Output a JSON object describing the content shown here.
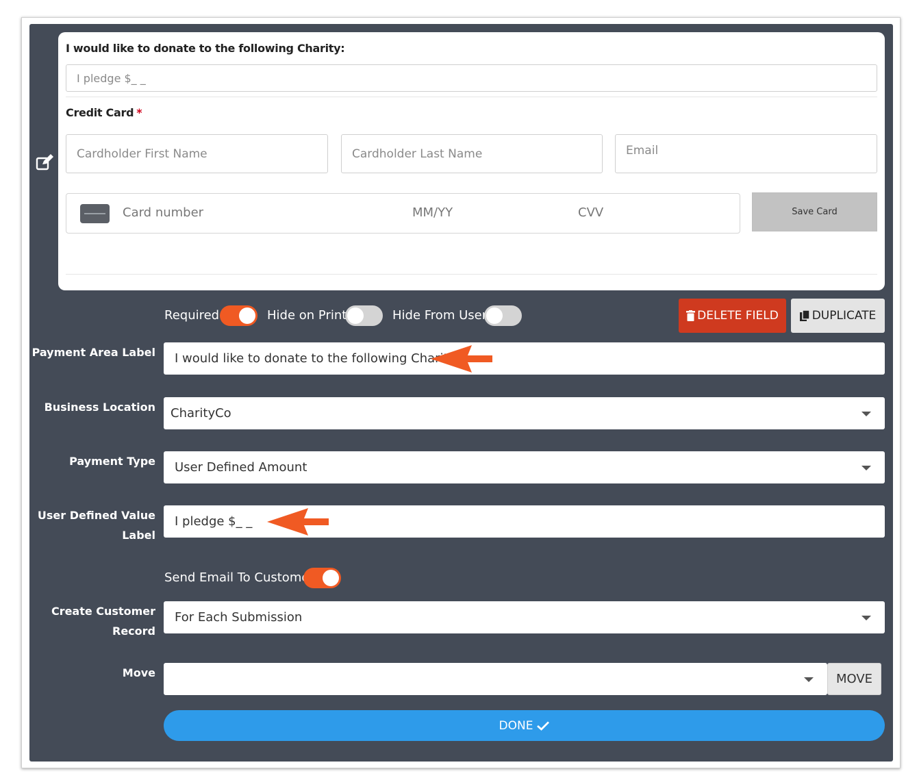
{
  "preview": {
    "charity_label": "I would like to donate to the following Charity:",
    "pledge_placeholder": "I pledge $_ _",
    "credit_card_label": "Credit Card",
    "required_star": "*",
    "first_name_placeholder": "Cardholder First Name",
    "last_name_placeholder": "Cardholder Last Name",
    "email_placeholder": "Email",
    "card_number_placeholder": "Card number",
    "expiry_placeholder": "MM/YY",
    "cvv_placeholder": "CVV",
    "save_card_label": "Save Card"
  },
  "options": {
    "required_label": "Required",
    "required_on": true,
    "hide_print_label": "Hide on Print",
    "hide_print_on": false,
    "hide_user_label": "Hide From User",
    "hide_user_on": false
  },
  "actions": {
    "delete_label": "DELETE FIELD",
    "duplicate_label": "DUPLICATE"
  },
  "settings": {
    "payment_area_label": "Payment Area Label",
    "payment_area_value": "I would like to donate to the following Charity:",
    "business_location_label": "Business Location",
    "business_location_value": "CharityCo",
    "payment_type_label": "Payment Type",
    "payment_type_value": "User Defined Amount",
    "user_defined_label_line1": "User Defined Value",
    "user_defined_label_line2": "Label",
    "user_defined_value": "I pledge $_ _",
    "send_email_label": "Send Email To Customer",
    "send_email_on": true,
    "create_record_label_line1": "Create Customer",
    "create_record_label_line2": "Record",
    "create_record_value": "For Each Submission",
    "move_label": "Move",
    "move_value": "",
    "move_button": "MOVE",
    "done_button": "DONE"
  },
  "colors": {
    "panel": "#444b57",
    "accent_orange": "#f05a23",
    "delete_red": "#cf3a1f",
    "done_blue": "#2e9bea"
  },
  "icons": [
    "edit-icon",
    "trash-icon",
    "copy-icon",
    "card-icon",
    "caret-down-icon",
    "checkmark-icon",
    "arrow-annotation"
  ]
}
